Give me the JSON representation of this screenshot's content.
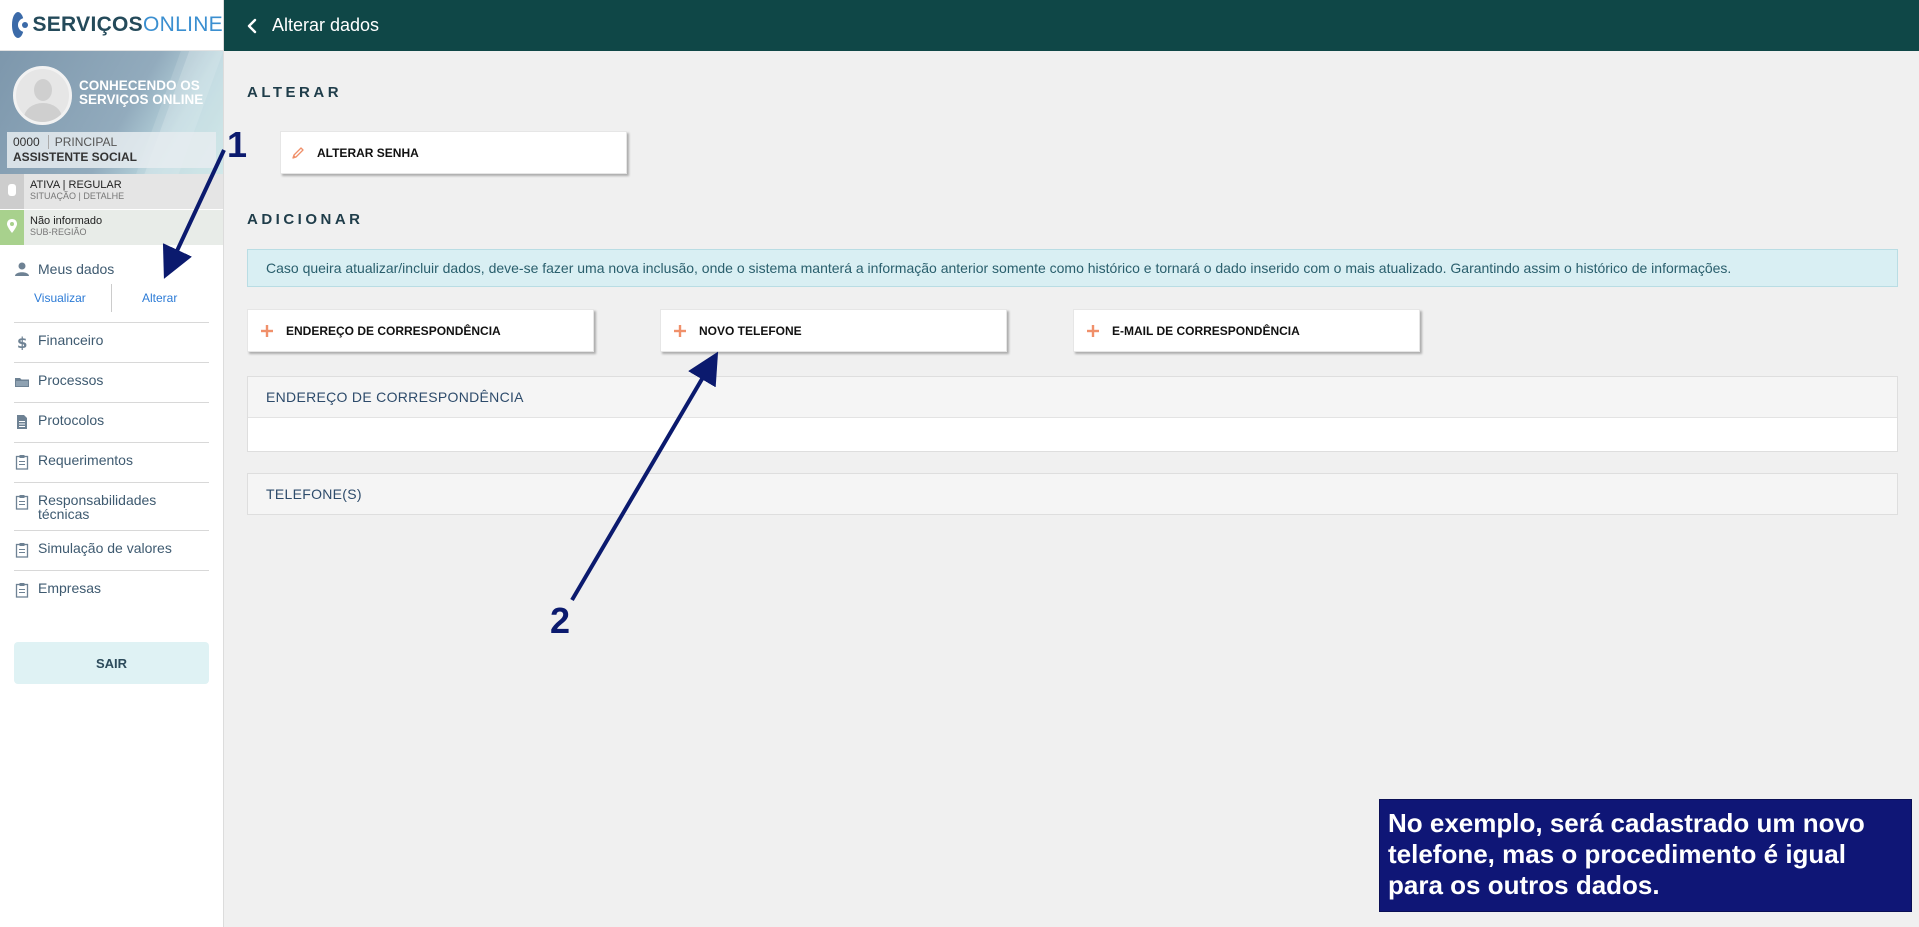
{
  "brand": {
    "part1": "SERVIÇOS",
    "part2": "ONLINE"
  },
  "profile": {
    "title": "CONHECENDO OS SERVIÇOS ONLINE",
    "code": "0000",
    "type": "PRINCIPAL",
    "role": "ASSISTENTE SOCIAL"
  },
  "status": {
    "situation": {
      "main": "ATIVA | REGULAR",
      "sub": "SITUAÇÃO | DETALHE"
    },
    "region": {
      "main": "Não informado",
      "sub": "SUB-REGIÃO"
    }
  },
  "nav": {
    "meus_dados": "Meus dados",
    "visualizar": "Visualizar",
    "alterar": "Alterar",
    "items": [
      {
        "label": "Financeiro",
        "icon": "dollar-icon"
      },
      {
        "label": "Processos",
        "icon": "folder-icon"
      },
      {
        "label": "Protocolos",
        "icon": "document-icon"
      },
      {
        "label": "Requerimentos",
        "icon": "clipboard-icon"
      },
      {
        "label": "Responsabilidades técnicas",
        "icon": "clipboard-icon"
      },
      {
        "label": "Simulação de valores",
        "icon": "clipboard-icon"
      },
      {
        "label": "Empresas",
        "icon": "clipboard-icon"
      }
    ],
    "sair": "SAIR"
  },
  "header": {
    "title": "Alterar dados"
  },
  "main": {
    "alterar_title": "ALTERAR",
    "alterar_senha": "ALTERAR SENHA",
    "adicionar_title": "ADICIONAR",
    "info": "Caso queira atualizar/incluir dados, deve-se fazer uma nova inclusão, onde o sistema manterá a informação anterior somente como histórico e tornará o dado inserido com o mais atualizado. Garantindo assim o histórico de informações.",
    "buttons": {
      "endereco": "ENDEREÇO DE CORRESPONDÊNCIA",
      "telefone": "NOVO TELEFONE",
      "email": "E-MAIL DE CORRESPONDÊNCIA"
    },
    "panels": {
      "endereco": "ENDEREÇO DE CORRESPONDÊNCIA",
      "telefone": "TELEFONE(S)"
    }
  },
  "annotations": {
    "num1": "1",
    "num2": "2",
    "note": "No exemplo, será cadastrado um novo telefone, mas o procedimento é igual para os outros dados."
  },
  "colors": {
    "header_bg": "#0f4747",
    "accent_orange": "#f0906a",
    "link_blue": "#2c7bd6",
    "annotation_navy": "#0f1676"
  }
}
